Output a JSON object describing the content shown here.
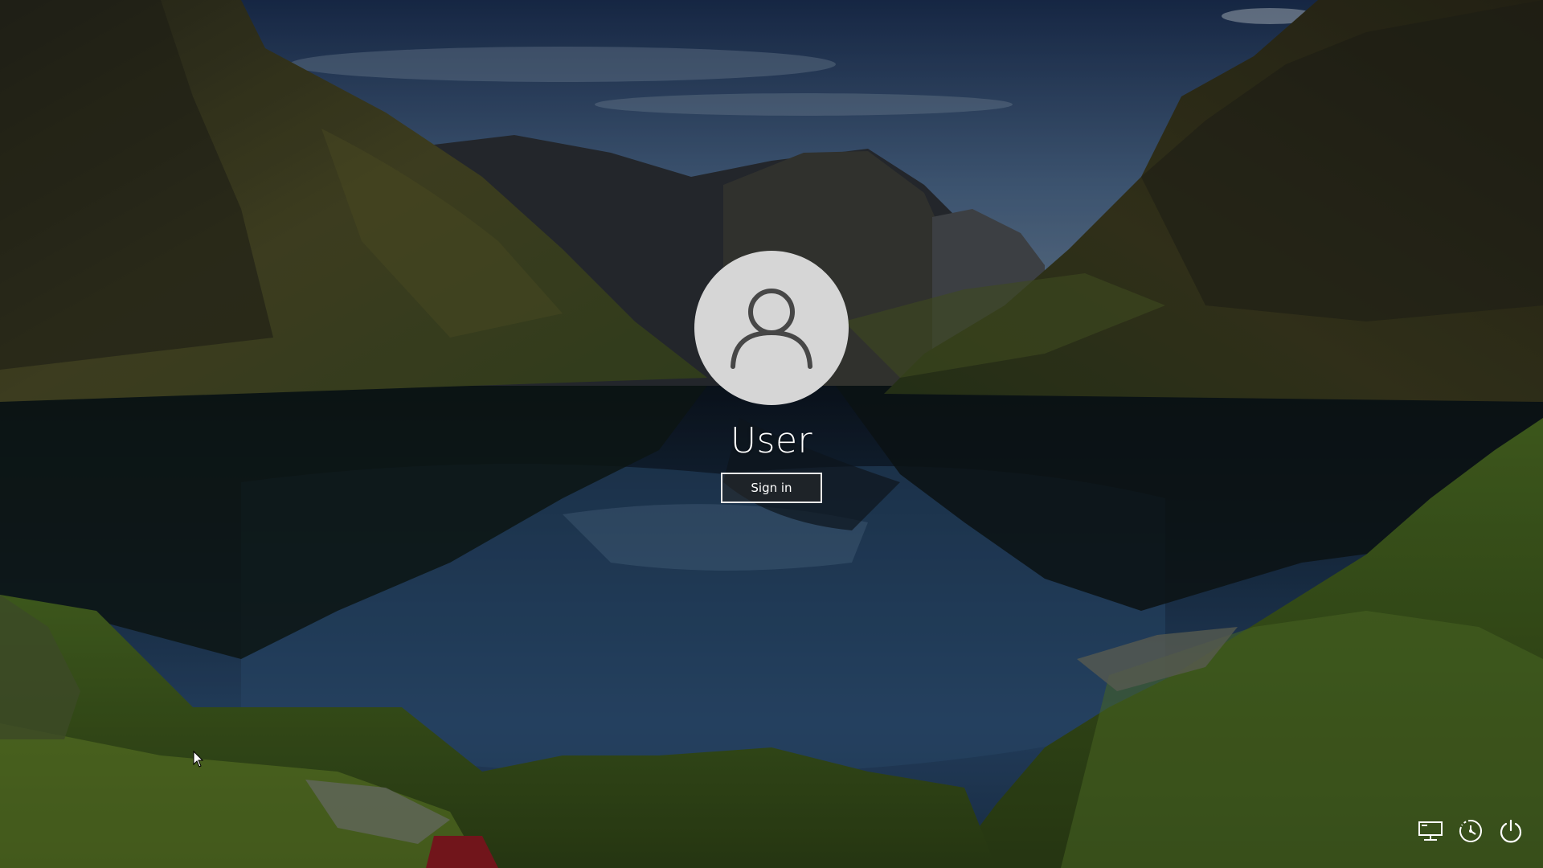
{
  "user": {
    "name": "User",
    "signin_label": "Sign in"
  },
  "tray": {
    "icons": [
      "network-icon",
      "ease-of-access-icon",
      "power-icon"
    ]
  },
  "colors": {
    "avatar_bg": "#d6d6d6",
    "avatar_glyph": "#474747",
    "text": "#ffffff",
    "button_border": "#e8e8e8"
  }
}
